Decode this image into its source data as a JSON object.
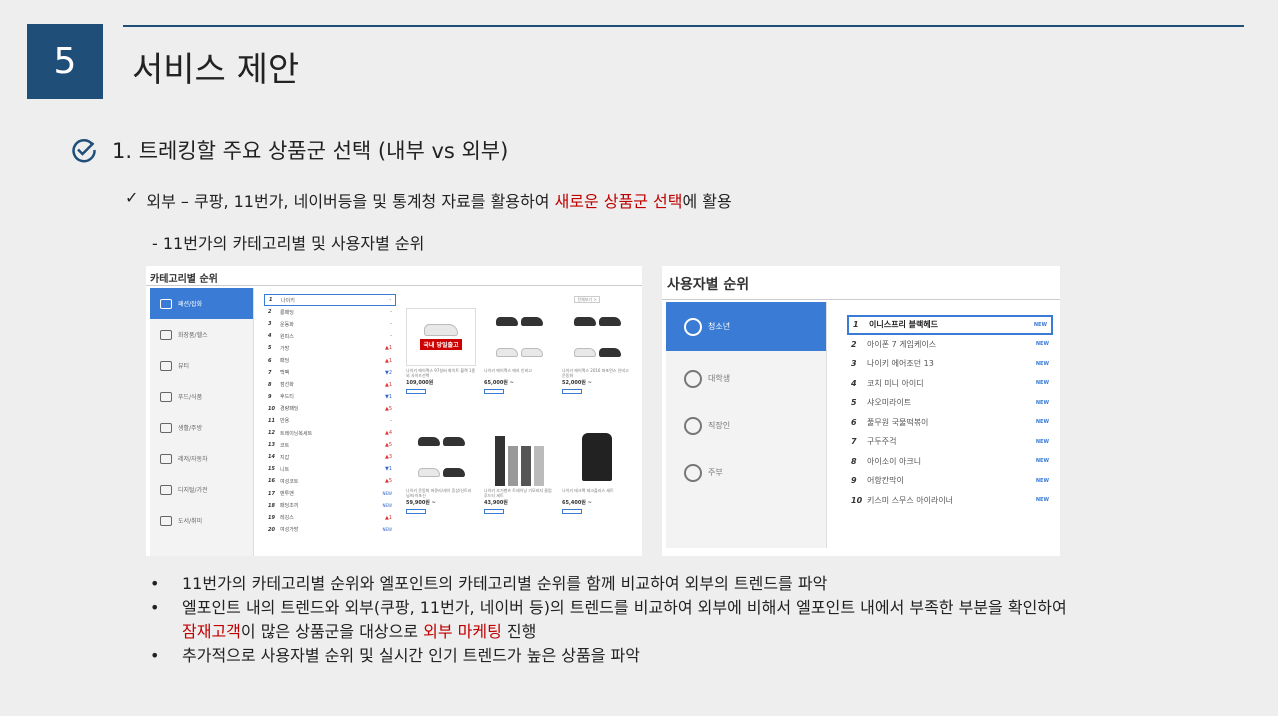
{
  "slide": {
    "number": "5",
    "title": "서비스 제안"
  },
  "section": {
    "heading": "1. 트레킹할 주요 상품군 선택 (내부 vs 외부)"
  },
  "subpoint": {
    "check": "✓",
    "text_before": "외부 – 쿠팡, 11번가, 네이버등을 및 통계청 자료를 활용하여 ",
    "highlight": "새로운 상품군 선택",
    "text_after": "에 활용"
  },
  "dash_line": "- 11번가의 카테고리별 및 사용자별 순위",
  "left_screenshot": {
    "title": "카테고리별 순위",
    "more_button": "전체보기 >",
    "sidebar": [
      {
        "label": "패션/잡화",
        "active": true
      },
      {
        "label": "화장품/헬스",
        "active": false
      },
      {
        "label": "뷰티",
        "active": false
      },
      {
        "label": "푸드/식품",
        "active": false
      },
      {
        "label": "생활/주방",
        "active": false
      },
      {
        "label": "레저/자동차",
        "active": false
      },
      {
        "label": "디지털/가전",
        "active": false
      },
      {
        "label": "도서/취미",
        "active": false
      }
    ],
    "ranking": [
      {
        "rank": "1",
        "name": "나이키",
        "change": "-"
      },
      {
        "rank": "2",
        "name": "롱패딩",
        "change": "-"
      },
      {
        "rank": "3",
        "name": "운동화",
        "change": "-"
      },
      {
        "rank": "4",
        "name": "원피스",
        "change": "-"
      },
      {
        "rank": "5",
        "name": "가방",
        "change": "▲1"
      },
      {
        "rank": "6",
        "name": "패딩",
        "change": "▲1"
      },
      {
        "rank": "7",
        "name": "백팩",
        "change": "▼2"
      },
      {
        "rank": "8",
        "name": "점선화",
        "change": "▲1"
      },
      {
        "rank": "9",
        "name": "후드티",
        "change": "▼1"
      },
      {
        "rank": "10",
        "name": "경량패딩",
        "change": "▲5"
      },
      {
        "rank": "11",
        "name": "반용",
        "change": "-"
      },
      {
        "rank": "12",
        "name": "트레이닝복세트",
        "change": "▲4"
      },
      {
        "rank": "13",
        "name": "코트",
        "change": "▲5"
      },
      {
        "rank": "14",
        "name": "지갑",
        "change": "▲3"
      },
      {
        "rank": "15",
        "name": "니트",
        "change": "▼1"
      },
      {
        "rank": "16",
        "name": "여성코트",
        "change": "▲5"
      },
      {
        "rank": "17",
        "name": "맨투맨",
        "change": "NEW"
      },
      {
        "rank": "18",
        "name": "패딩조끼",
        "change": "NEW"
      },
      {
        "rank": "19",
        "name": "레깅스",
        "change": "▲1"
      },
      {
        "rank": "20",
        "name": "여성가방",
        "change": "NEW"
      }
    ],
    "products": [
      {
        "caption": "나이키 에어맥스 97실버 화이트 블랙 1종외 사이즈선택",
        "price": "109,000원",
        "badge": "국내 당일출고"
      },
      {
        "caption": "나이키 에어맥스 에라 인비고",
        "price": "65,000원 ~",
        "badge": ""
      },
      {
        "caption": "나이키 에어맥스 2016 퍼포먼스 인비고 운동화",
        "price": "52,000원 ~",
        "badge": ""
      },
      {
        "caption": "나이키 운동화 머큐리/세이 증상/신트러닝/타이포신",
        "price": "59,900원 ~",
        "badge": ""
      },
      {
        "caption": "나이키 조거팬츠 트레이닝 기모바지 클럽 후드티 세트",
        "price": "43,900원",
        "badge": ""
      },
      {
        "caption": "나이키 테크팩 테크플리스 세트",
        "price": "65,400원 ~",
        "badge": ""
      }
    ]
  },
  "right_screenshot": {
    "title": "사용자별 순위",
    "sidebar": [
      {
        "label": "청소년",
        "active": true
      },
      {
        "label": "대학생",
        "active": false
      },
      {
        "label": "직장인",
        "active": false
      },
      {
        "label": "주부",
        "active": false
      }
    ],
    "ranking": [
      {
        "rank": "1",
        "name": "이니스프리 블랙헤드",
        "badge": "NEW"
      },
      {
        "rank": "2",
        "name": "아이폰 7 게임케이스",
        "badge": "NEW"
      },
      {
        "rank": "3",
        "name": "나이키 에어조던 13",
        "badge": "NEW"
      },
      {
        "rank": "4",
        "name": "코치 미니 아이디",
        "badge": "NEW"
      },
      {
        "rank": "5",
        "name": "샤오미라이트",
        "badge": "NEW"
      },
      {
        "rank": "6",
        "name": "풀무원 국물떡볶이",
        "badge": "NEW"
      },
      {
        "rank": "7",
        "name": "구두주걱",
        "badge": "NEW"
      },
      {
        "rank": "8",
        "name": "아이소이 아크니",
        "badge": "NEW"
      },
      {
        "rank": "9",
        "name": "어항칸막이",
        "badge": "NEW"
      },
      {
        "rank": "10",
        "name": "키스미 스무스 아이라이너",
        "badge": "NEW"
      }
    ]
  },
  "bullets": {
    "b1": "11번가의 카테고리별 순위와 엘포인트의 카테고리별 순위를 함께 비교하여 외부의 트렌드를 파악",
    "b2_line1": "엘포인트 내의 트렌드와 외부(쿠팡, 11번가, 네이버 등)의 트렌드를 비교하여 외부에 비해서 엘포인트 내에서 부족한 부분을 확인하여",
    "b2_red1": "잠재고객",
    "b2_mid": "이 많은 상품군을 대상으로 ",
    "b2_red2": "외부 마케팅",
    "b2_end": " 진행",
    "b3": "추가적으로 사용자별 순위 및 실시간 인기 트렌드가 높은 상품을 파악",
    "marker": "•"
  },
  "colors": {
    "accent": "#1f4e79",
    "highlight_red": "#c00000",
    "ui_blue": "#3a7bd5"
  }
}
